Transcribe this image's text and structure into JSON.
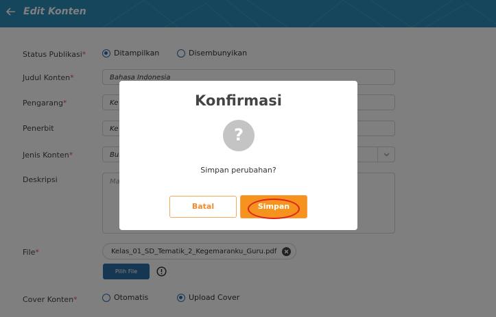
{
  "header": {
    "title": "Edit Konten"
  },
  "form": {
    "status": {
      "label": "Status Publikasi",
      "required": "*",
      "options": [
        "Ditampilkan",
        "Disembunyikan"
      ],
      "selected": "Ditampilkan"
    },
    "judul": {
      "label": "Judul Konten",
      "required": "*",
      "value": "Bahasa Indonesia"
    },
    "pengarang": {
      "label": "Pengarang",
      "required": "*",
      "value": "Ke"
    },
    "penerbit": {
      "label": "Penerbit",
      "value": "Ke"
    },
    "jenis": {
      "label": "Jenis Konten",
      "required": "*",
      "value": "Buk"
    },
    "deskripsi": {
      "label": "Deskripsi",
      "placeholder": "Ma"
    },
    "file": {
      "label": "File",
      "required": "*",
      "filename": "Kelas_01_SD_Tematik_2_Kegemaranku_Guru.pdf",
      "pick_label": "Pilih File"
    },
    "cover": {
      "label": "Cover Konten",
      "required": "*",
      "options": [
        "Otomatis",
        "Upload Cover"
      ],
      "selected": "Upload Cover"
    }
  },
  "modal": {
    "title": "Konfirmasi",
    "icon": "?",
    "message": "Simpan perubahan?",
    "cancel_label": "Batal",
    "save_label": "Simpan"
  },
  "colors": {
    "header": "#2c8db8",
    "primary_button": "#2c6ea6",
    "accent": "#f6931e",
    "highlight": "#e0201b"
  }
}
